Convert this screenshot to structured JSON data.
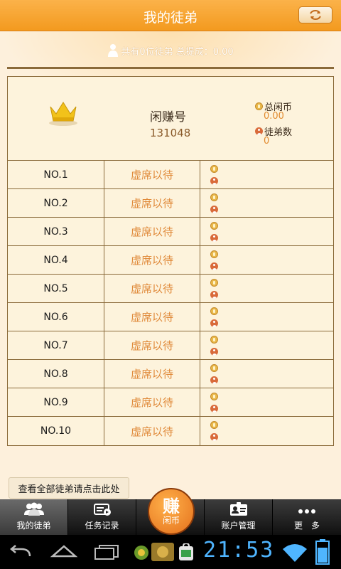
{
  "header": {
    "title": "我的徒弟"
  },
  "summary": {
    "text": "共有0位徒弟 总提成：0.00"
  },
  "master": {
    "name": "闲赚号",
    "id": "131048",
    "coins_label": "总闲币",
    "coins_value": "0.00",
    "apprentices_label": "徒弟数",
    "apprentices_value": "0"
  },
  "rows": [
    {
      "no": "NO.1",
      "name": "虚席以待"
    },
    {
      "no": "NO.2",
      "name": "虚席以待"
    },
    {
      "no": "NO.3",
      "name": "虚席以待"
    },
    {
      "no": "NO.4",
      "name": "虚席以待"
    },
    {
      "no": "NO.5",
      "name": "虚席以待"
    },
    {
      "no": "NO.6",
      "name": "虚席以待"
    },
    {
      "no": "NO.7",
      "name": "虚席以待"
    },
    {
      "no": "NO.8",
      "name": "虚席以待"
    },
    {
      "no": "NO.9",
      "name": "虚席以待"
    },
    {
      "no": "NO.10",
      "name": "虚席以待"
    }
  ],
  "view_all": "查看全部徒弟请点击此处",
  "nav": {
    "items": [
      {
        "label": "我的徒弟",
        "icon": "people-icon"
      },
      {
        "label": "任务记录",
        "icon": "task-record-icon"
      },
      {
        "label": "账户管理",
        "icon": "id-card-icon"
      },
      {
        "label": "更　多",
        "icon": "more-dots-icon"
      }
    ],
    "center_big": "赚",
    "center_small": "闲币"
  },
  "system": {
    "clock": "21:53"
  },
  "colors": {
    "header": "#f39a1f",
    "accent_text": "#e08a3a",
    "background": "#fdf0dc",
    "clock": "#4fb5ff"
  }
}
